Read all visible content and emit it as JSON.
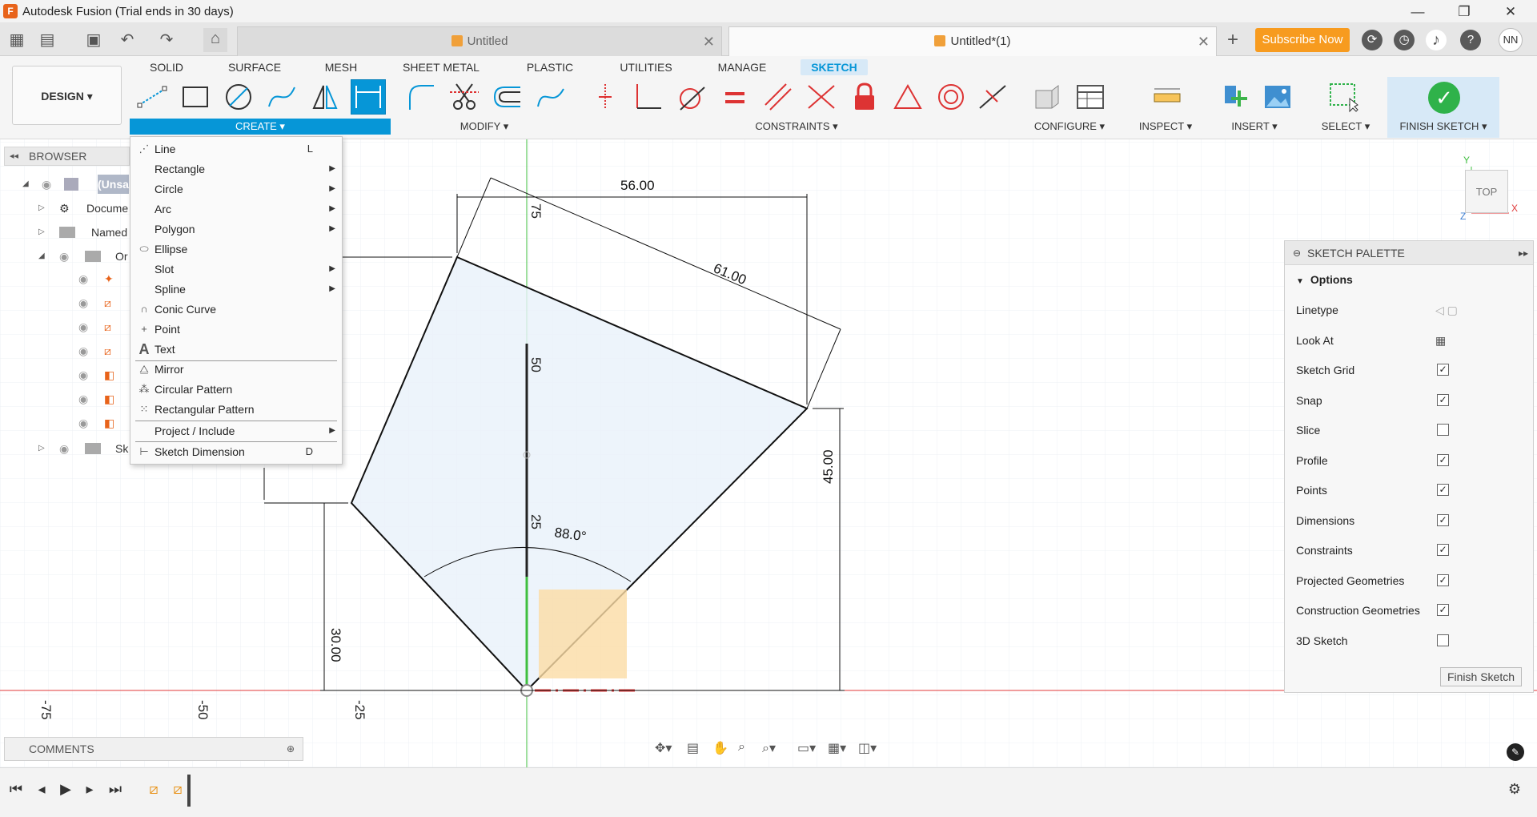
{
  "window": {
    "title": "Autodesk Fusion (Trial ends in 30 days)",
    "logo": "F",
    "min": "—",
    "max": "❐",
    "close": "✕"
  },
  "tabs": [
    {
      "label": "Untitled",
      "close": "✕"
    },
    {
      "label": "Untitled*(1)",
      "close": "✕"
    }
  ],
  "header": {
    "subscribe": "Subscribe Now",
    "avatar": "NN",
    "add_tab": "+",
    "help": "?"
  },
  "workspace": {
    "label": "DESIGN ▾"
  },
  "ws_tabs": [
    "SOLID",
    "SURFACE",
    "MESH",
    "SHEET METAL",
    "PLASTIC",
    "UTILITIES",
    "MANAGE",
    "SKETCH"
  ],
  "groups": {
    "create": "CREATE ▾",
    "modify": "MODIFY ▾",
    "constraints": "CONSTRAINTS ▾",
    "configure": "CONFIGURE ▾",
    "inspect": "INSPECT ▾",
    "insert": "INSERT ▾",
    "select": "SELECT ▾",
    "finish": "FINISH SKETCH ▾"
  },
  "browser": {
    "title": "BROWSER",
    "rows": [
      "(Unsa",
      "Docume",
      "Named",
      "Or",
      "Sk"
    ]
  },
  "create_menu": {
    "items": [
      {
        "label": "Line",
        "key": "L",
        "icon": "line-icon"
      },
      {
        "label": "Rectangle",
        "arrow": true
      },
      {
        "label": "Circle",
        "arrow": true
      },
      {
        "label": "Arc",
        "arrow": true
      },
      {
        "label": "Polygon",
        "arrow": true
      },
      {
        "label": "Ellipse",
        "icon": "ellipse-icon"
      },
      {
        "label": "Slot",
        "arrow": true
      },
      {
        "label": "Spline",
        "arrow": true
      },
      {
        "label": "Conic Curve",
        "icon": "conic-icon"
      },
      {
        "label": "Point",
        "icon": "point-icon"
      },
      {
        "label": "Text",
        "icon": "text-icon"
      },
      {
        "label": "Mirror",
        "icon": "mirror-icon"
      },
      {
        "label": "Circular Pattern",
        "icon": "circular-pattern-icon"
      },
      {
        "label": "Rectangular Pattern",
        "icon": "rect-pattern-icon"
      },
      {
        "label": "Project / Include",
        "arrow": true
      },
      {
        "label": "Sketch Dimension",
        "key": "D",
        "icon": "dimension-icon"
      }
    ]
  },
  "sketch": {
    "dims": {
      "d1": "56.00",
      "d2": "61.00",
      "d3": "45.00",
      "d4": "30.00",
      "angle": "88.0°"
    },
    "axis_labels": {
      "a1": "75",
      "a2": "50",
      "a3": "25"
    },
    "x_ticks": [
      "-75",
      "-50",
      "-25"
    ],
    "view": {
      "label": "TOP",
      "x": "X",
      "y": "Y",
      "z": "Z"
    }
  },
  "palette": {
    "title": "SKETCH PALETTE",
    "section": "Options",
    "rows": [
      {
        "label": "Linetype",
        "type": "icon"
      },
      {
        "label": "Look At",
        "type": "icon"
      },
      {
        "label": "Sketch Grid",
        "checked": true
      },
      {
        "label": "Snap",
        "checked": true
      },
      {
        "label": "Slice",
        "checked": false
      },
      {
        "label": "Profile",
        "checked": true
      },
      {
        "label": "Points",
        "checked": true
      },
      {
        "label": "Dimensions",
        "checked": true
      },
      {
        "label": "Constraints",
        "checked": true
      },
      {
        "label": "Projected Geometries",
        "checked": true
      },
      {
        "label": "Construction Geometries",
        "checked": true
      },
      {
        "label": "3D Sketch",
        "checked": false
      }
    ],
    "finish": "Finish Sketch"
  },
  "comments": {
    "label": "COMMENTS"
  }
}
